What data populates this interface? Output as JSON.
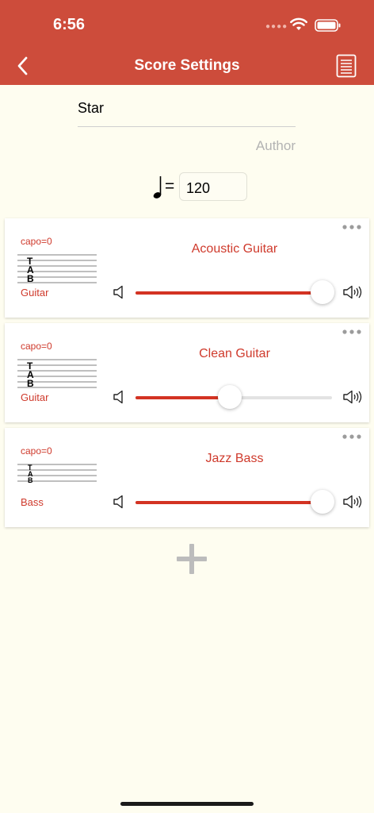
{
  "status": {
    "time": "6:56"
  },
  "header": {
    "title": "Score Settings"
  },
  "score": {
    "title": "Star",
    "author_placeholder": "Author"
  },
  "tempo": {
    "equals": "=",
    "value": "120"
  },
  "tracks": [
    {
      "capo": "capo=0",
      "instrument": "Guitar",
      "name": "Acoustic Guitar",
      "volume": 0.95
    },
    {
      "capo": "capo=0",
      "instrument": "Guitar",
      "name": "Clean Guitar",
      "volume": 0.48
    },
    {
      "capo": "capo=0",
      "instrument": "Bass",
      "name": "Jazz Bass",
      "volume": 0.95
    }
  ],
  "tab_letters": [
    "T",
    "A",
    "B"
  ],
  "colors": {
    "header": "#cd4c3b",
    "accent": "#cf3a2c",
    "background": "#fefdf0"
  },
  "icons": {
    "back": "chevron-left-icon",
    "document": "document-list-icon",
    "more": "ellipsis-icon",
    "volume_low": "speaker-icon",
    "volume_high": "speaker-loud-icon",
    "add": "plus-icon",
    "tempo": "quarter-note-icon"
  }
}
